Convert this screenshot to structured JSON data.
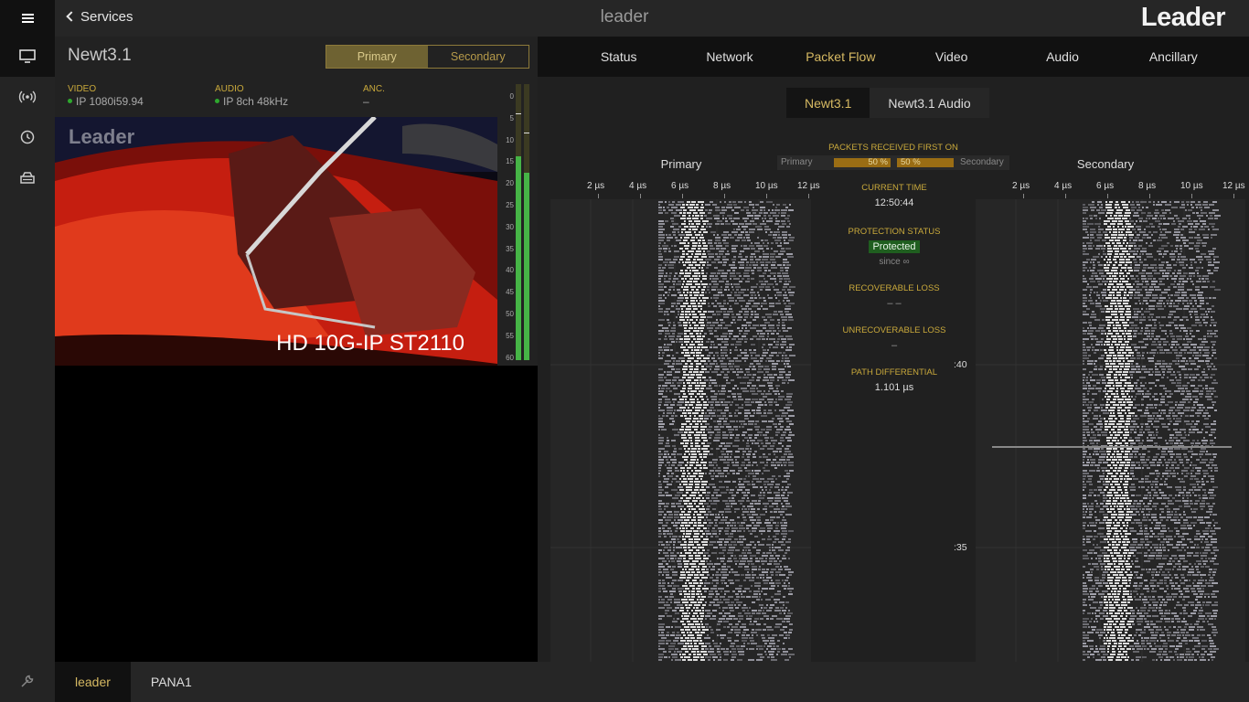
{
  "topbar": {
    "back_label": "Services",
    "title": "leader",
    "brand": "Leader"
  },
  "service": {
    "name": "Newt3.1",
    "paths": [
      "Primary",
      "Secondary"
    ],
    "selected_path": "Primary",
    "video_label": "VIDEO",
    "video_value": "IP 1080i59.94",
    "audio_label": "AUDIO",
    "audio_value": "IP 8ch 48kHz",
    "anc_label": "ANC.",
    "anc_value": "–"
  },
  "preview": {
    "logo": "Leader",
    "caption": "HD 10G-IP ST2110"
  },
  "meter": {
    "scale": [
      "0",
      "5",
      "10",
      "15",
      "20",
      "25",
      "30",
      "35",
      "40",
      "45",
      "50",
      "55",
      "60"
    ],
    "levels": [
      0.74,
      0.68
    ]
  },
  "tabs": [
    "Status",
    "Network",
    "Packet Flow",
    "Video",
    "Audio",
    "Ancillary"
  ],
  "active_tab": "Packet Flow",
  "flow_tabs": [
    "Newt3.1",
    "Newt3.1 Audio"
  ],
  "active_flow_tab": "Newt3.1",
  "packet_flow": {
    "primary_title": "Primary",
    "secondary_title": "Secondary",
    "packets_first_title": "PACKETS RECEIVED FIRST ON",
    "packets_primary_label": "Primary",
    "packets_secondary_label": "Secondary",
    "primary_pct": "50 %",
    "secondary_pct": "50 %",
    "x_ticks": [
      "2 µs",
      "4 µs",
      "6 µs",
      "8 µs",
      "10 µs",
      "12 µs"
    ],
    "time_labels": [
      ":40",
      ":35"
    ],
    "current_time_label": "CURRENT TIME",
    "current_time": "12:50:44",
    "protection_label": "PROTECTION STATUS",
    "protection_value": "Protected",
    "protection_since": "since ∞",
    "recoverable_label": "RECOVERABLE LOSS",
    "recoverable_value": "–      –",
    "unrecoverable_label": "UNRECOVERABLE LOSS",
    "unrecoverable_value": "–",
    "path_diff_label": "PATH DIFFERENTIAL",
    "path_diff_value": "1.101 µs"
  },
  "bottom_tabs": [
    "leader",
    "PANA1"
  ],
  "active_bottom_tab": "leader",
  "colors": {
    "accent": "#d6b962",
    "ok": "#2ea82e",
    "panel": "#202020"
  }
}
